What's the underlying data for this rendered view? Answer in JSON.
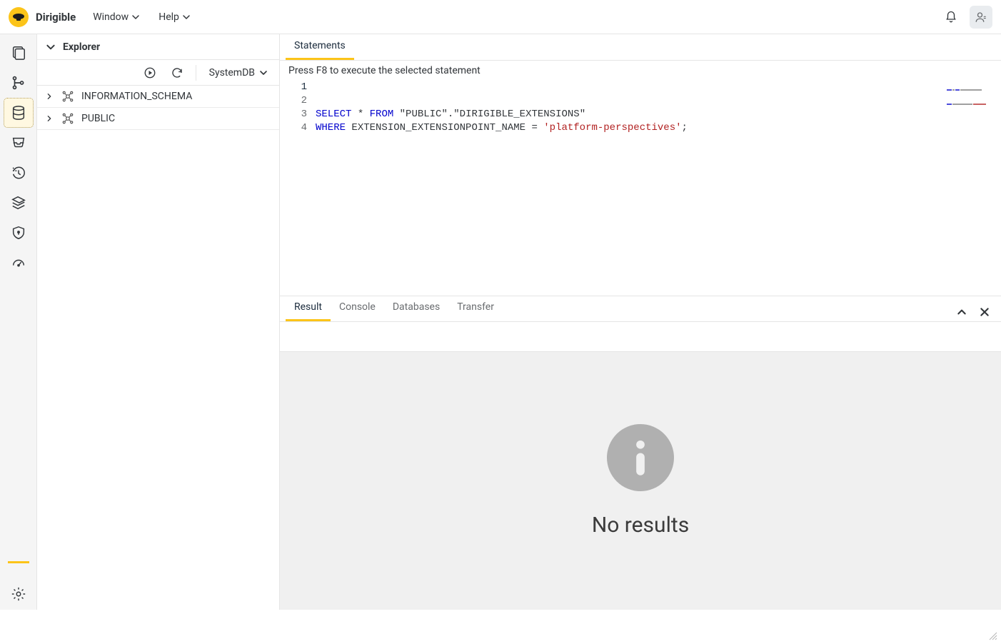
{
  "header": {
    "brand": "Dirigible",
    "menus": [
      "Window",
      "Help"
    ]
  },
  "activitybar": {
    "items": [
      {
        "name": "workbench-icon"
      },
      {
        "name": "git-icon"
      },
      {
        "name": "database-icon",
        "active": true
      },
      {
        "name": "inbox-icon"
      },
      {
        "name": "history-icon"
      },
      {
        "name": "tags-icon"
      },
      {
        "name": "shield-icon"
      },
      {
        "name": "gauge-icon"
      }
    ],
    "bottom": {
      "name": "gear-icon"
    }
  },
  "sidebar": {
    "title": "Explorer",
    "database": "SystemDB",
    "items": [
      {
        "label": "INFORMATION_SCHEMA"
      },
      {
        "label": "PUBLIC"
      }
    ]
  },
  "main": {
    "tabs": [
      {
        "label": "Statements",
        "active": true
      }
    ],
    "hint": "Press F8 to execute the selected statement",
    "code": {
      "lines": [
        "1",
        "2",
        "3",
        "4"
      ],
      "line1_a": "SELECT",
      "line1_b": " * ",
      "line1_c": "FROM",
      "line1_d": " \"PUBLIC\".\"DIRIGIBLE_EXTENSIONS\"",
      "line2_a": "WHERE",
      "line2_b": " EXTENSION_EXTENSIONPOINT_NAME = ",
      "line2_c": "'platform-perspectives'",
      "line2_d": ";"
    }
  },
  "panel": {
    "tabs": [
      {
        "label": "Result",
        "active": true
      },
      {
        "label": "Console"
      },
      {
        "label": "Databases"
      },
      {
        "label": "Transfer"
      }
    ],
    "empty": "No results"
  }
}
